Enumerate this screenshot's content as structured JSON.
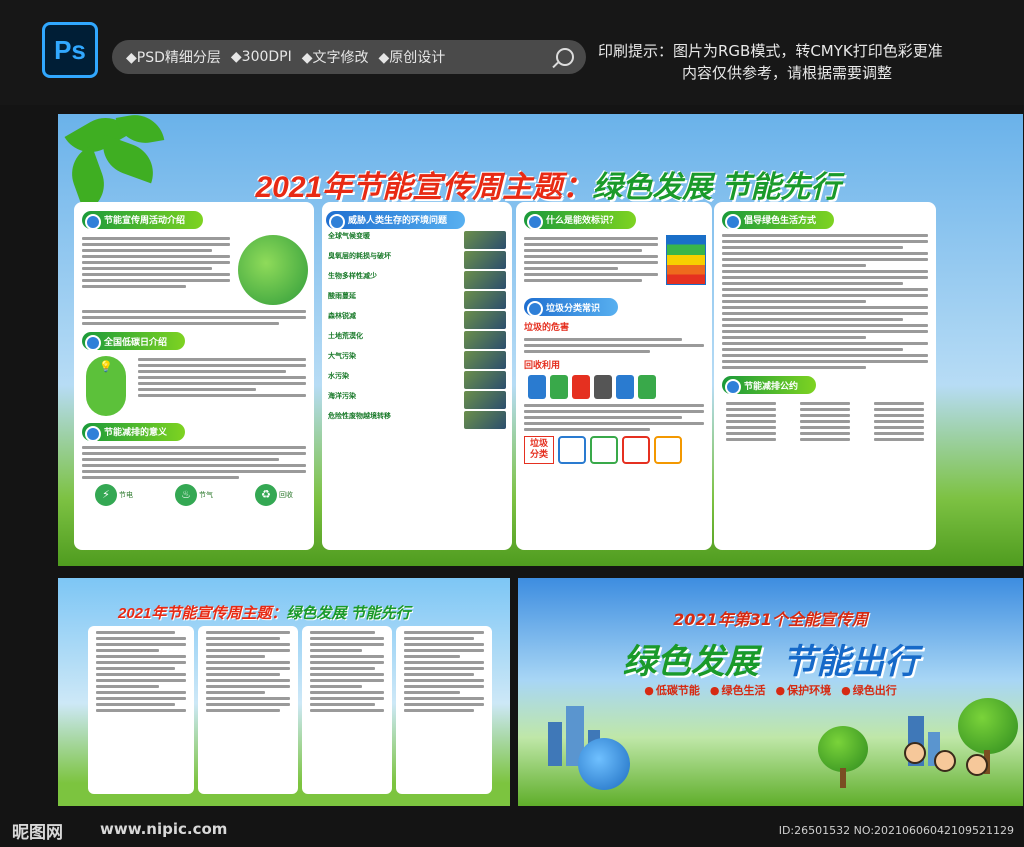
{
  "header": {
    "app_icon_label": "Ps",
    "features": [
      "◆PSD精细分层",
      "◆300DPI",
      "◆文字修改",
      "◆原创设计"
    ],
    "notice_line1": "印刷提示：图片为RGB模式，转CMYK打印色彩更准",
    "notice_line2": "内容仅供参考，请根据需要调整"
  },
  "main_board": {
    "title_red": "2021年节能宣传周主题：",
    "title_green": "绿色发展 节能先行",
    "panel1_sections": [
      "节能宣传周活动介绍",
      "全国低碳日介绍",
      "节能减排的意义"
    ],
    "panel1_icons": [
      "节电",
      "节气",
      "回收"
    ],
    "panel2_title": "威胁人类生存的环境问题",
    "threats": [
      "全球气候变暖",
      "臭氧层的耗损与破坏",
      "生物多样性减少",
      "酸雨蔓延",
      "森林锐减",
      "土地荒漠化",
      "大气污染",
      "水污染",
      "海洋污染",
      "危险性废物越境转移"
    ],
    "panel3_sections": [
      "什么是能效标识？",
      "垃圾分类常识"
    ],
    "garbage_harm": "垃圾的危害",
    "recycling": "回收利用",
    "sort_label": "垃圾分类",
    "panel4_sections": [
      "倡导绿色生活方式",
      "节能减排公约"
    ]
  },
  "left_board": {
    "title_red": "2021年节能宣传周主题：",
    "title_green": "绿色发展 节能先行"
  },
  "right_board": {
    "subtitle": "2021年第31个全能宣传周",
    "main_green": "绿色发展",
    "main_blue": "节能出行",
    "tags": [
      "低碳节能",
      "绿色生活",
      "保护环境",
      "绿色出行"
    ]
  },
  "footer": {
    "logo": "昵图网",
    "url": "www.nipic.com",
    "id": "ID:26501532 NO:20210606042109521129"
  },
  "colors": {
    "title_red": "#e82a14",
    "title_green": "#1a9a2a",
    "accent_blue": "#31a8ff"
  }
}
